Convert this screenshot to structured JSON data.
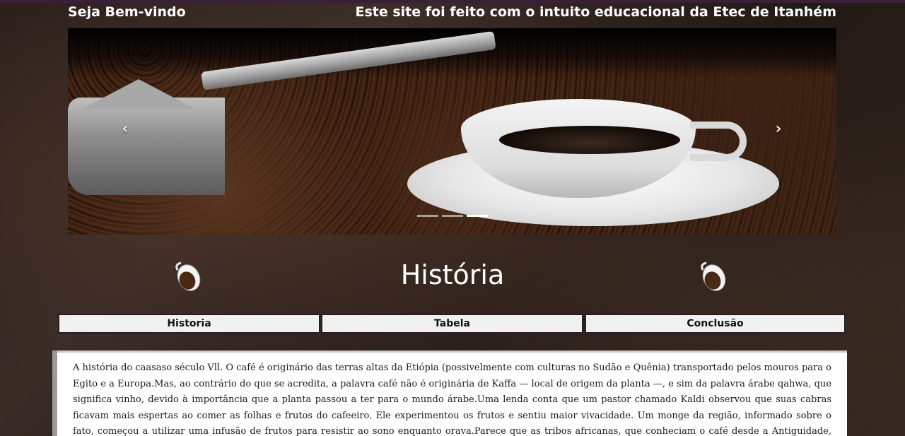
{
  "header": {
    "welcome": "Seja Bem-vindo",
    "tagline": "Este site foi feito com o intuito educacional da Etec de Itanhém"
  },
  "carousel": {
    "prev_glyph": "‹",
    "next_glyph": "›",
    "slide_count": 3,
    "active_slide": 3
  },
  "main": {
    "title": "História"
  },
  "tabs": [
    {
      "label": "Historia"
    },
    {
      "label": "Tabela"
    },
    {
      "label": "Conclusão"
    }
  ],
  "content": {
    "text": "A história do caasaso século Vll. O café é originário das terras altas da Etiópia (possivelmente com culturas no Sudão e Quênia) transportado pelos mouros para o Egito e a Europa.Mas, ao contrário do que se acredita, a palavra café não é originária de Kaffa — local de origem da planta —, e sim da palavra árabe qahwa, que significa vinho, devido à importância que a planta passou a ter para o mundo árabe.Uma lenda conta que um pastor chamado Kaldi observou que suas cabras ficavam mais espertas ao comer as folhas e frutos do cafeeiro. Ele experimentou os frutos e sentiu maior vivacidade. Um monge da região, informado sobre o fato, começou a utilizar uma infusão de frutos para resistir ao sono enquanto orava.Parece que as tribos africanas, que conheciam o café desde a Antiguidade, moíam seus grãos e faziam uma pasta utilizada"
  },
  "colors": {
    "background": "#2b1f1b",
    "tab_bg": "#f1f1f1",
    "tab_border": "#222222",
    "text_light": "#ffffff"
  },
  "icons": {
    "decor_left": "coffee-cup-icon",
    "decor_right": "coffee-cup-icon"
  }
}
